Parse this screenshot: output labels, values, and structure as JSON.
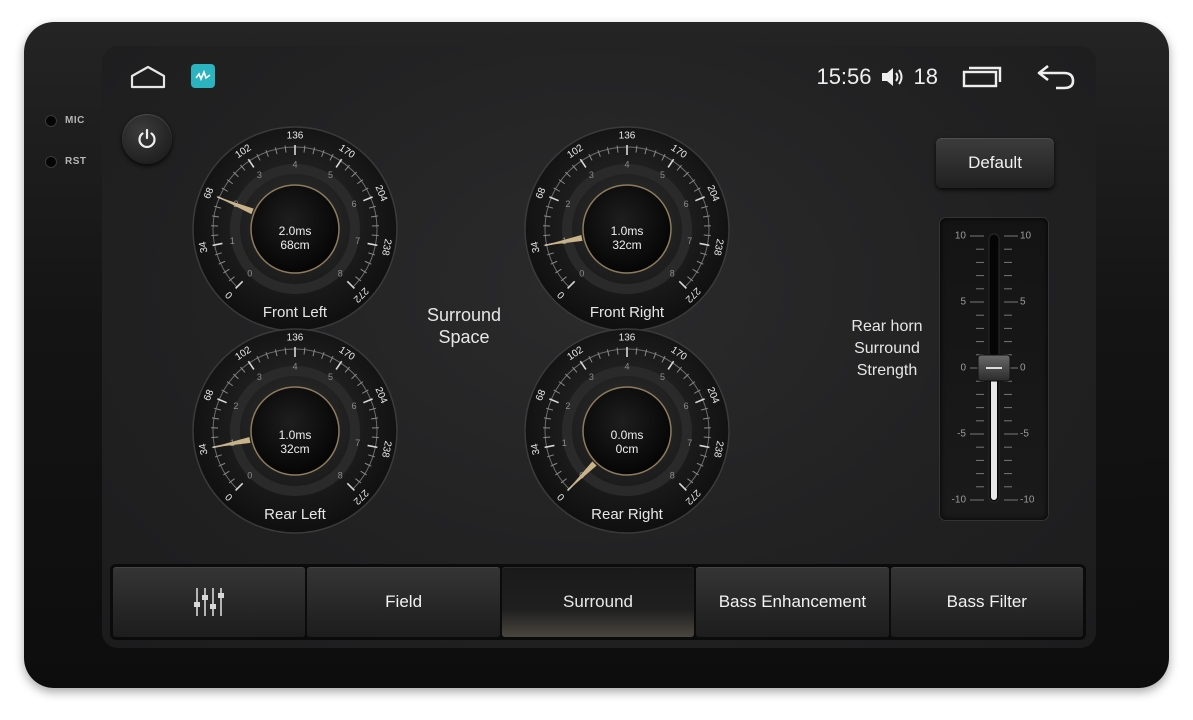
{
  "device": {
    "side_labels": [
      "MIC",
      "RST"
    ]
  },
  "status_bar": {
    "time": "15:56",
    "volume": "18",
    "icons": [
      "home-icon",
      "app-badge-icon",
      "volume-icon",
      "recent-apps-icon",
      "back-icon"
    ]
  },
  "power": {
    "icon": "power-icon"
  },
  "default_button": {
    "label": "Default"
  },
  "gauge_scale": {
    "outer_ticks": [
      "0",
      "34",
      "68",
      "102",
      "136",
      "170",
      "204",
      "238",
      "272"
    ],
    "inner_ticks": [
      "0",
      "1",
      "2",
      "3",
      "4",
      "5",
      "6",
      "7",
      "8"
    ]
  },
  "gauges": [
    {
      "label": "Front Left",
      "ms": "2.0ms",
      "cm": "68cm",
      "level": 2
    },
    {
      "label": "Front Right",
      "ms": "1.0ms",
      "cm": "32cm",
      "level": 1
    },
    {
      "label": "Rear Left",
      "ms": "1.0ms",
      "cm": "32cm",
      "level": 1
    },
    {
      "label": "Rear Right",
      "ms": "0.0ms",
      "cm": "0cm",
      "level": 0
    }
  ],
  "surround_space": {
    "line1": "Surround",
    "line2": "Space"
  },
  "rear_horn": {
    "line1": "Rear horn",
    "line2": "Surround",
    "line3": "Strength"
  },
  "strength_slider": {
    "scale": [
      "10",
      "5",
      "0",
      "-5",
      "-10"
    ],
    "min": -10,
    "max": 10,
    "value": 0
  },
  "tabs": [
    {
      "label": "",
      "icon": "equalizer-icon",
      "active": false
    },
    {
      "label": "Field",
      "active": false
    },
    {
      "label": "Surround",
      "active": true
    },
    {
      "label": "Bass Enhancement",
      "active": false
    },
    {
      "label": "Bass Filter",
      "active": false
    }
  ],
  "colors": {
    "needle": "#c9b48a",
    "accent_app": "#2bb3c0",
    "text": "#e6e6e6"
  }
}
